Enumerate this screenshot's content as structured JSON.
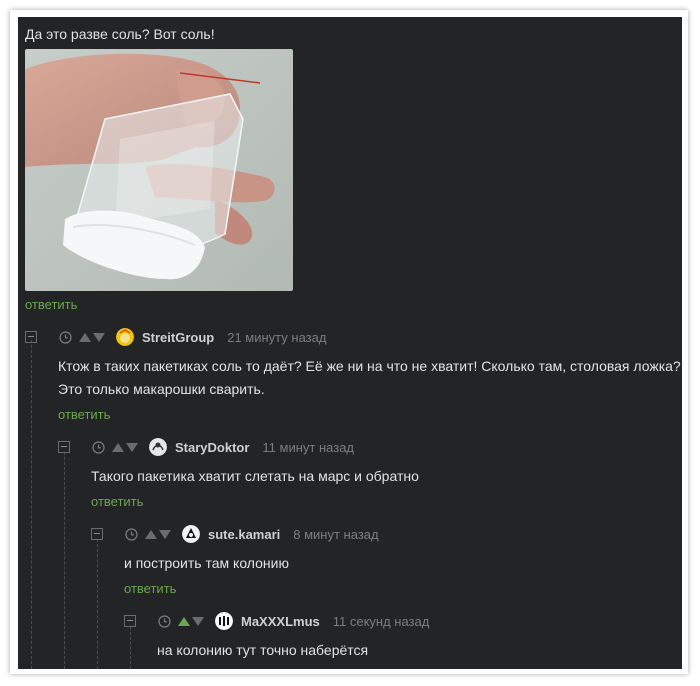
{
  "post": {
    "text": "Да это разве соль? Вот соль!",
    "reply_label": "ответить"
  },
  "comments": [
    {
      "username": "StreitGroup",
      "time": "21 минуту назад",
      "text": "Ктож в таких пакетиках соль то даёт? Её же ни на что не хватит! Сколько там, столовая ложка? Это только макарошки сварить.",
      "reply_label": "ответить"
    },
    {
      "username": "StaryDoktor",
      "time": "11 минут назад",
      "text": "Такого пакетика хватит слетать на марс и обратно",
      "reply_label": "ответить"
    },
    {
      "username": "sute.kamari",
      "time": "8 минут назад",
      "text": "и построить там колонию",
      "reply_label": "ответить"
    },
    {
      "username": "MaXXXLmus",
      "time": "11 секунд назад",
      "text": "на колонию тут точно наберётся"
    }
  ],
  "colors": {
    "background": "#232426",
    "text": "#e2e2e2",
    "reply_link": "#6aa84f",
    "upvote_active": "#6aa84f",
    "muted": "#7c7d80"
  }
}
